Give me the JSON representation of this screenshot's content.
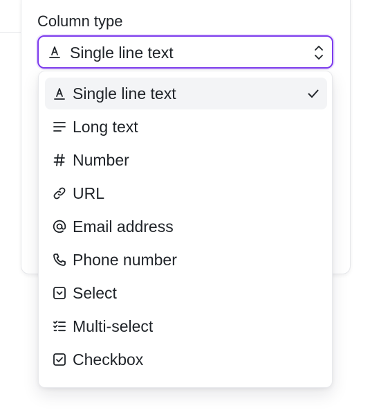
{
  "field": {
    "label": "Column type",
    "selected_value": "Single line text",
    "selected_icon": "text-a-underline-icon"
  },
  "menu": {
    "items": [
      {
        "label": "Single line text",
        "icon": "text-a-underline-icon",
        "selected": true
      },
      {
        "label": "Long text",
        "icon": "lines-icon",
        "selected": false
      },
      {
        "label": "Number",
        "icon": "hash-icon",
        "selected": false
      },
      {
        "label": "URL",
        "icon": "link-icon",
        "selected": false
      },
      {
        "label": "Email address",
        "icon": "at-sign-icon",
        "selected": false
      },
      {
        "label": "Phone number",
        "icon": "phone-icon",
        "selected": false
      },
      {
        "label": "Select",
        "icon": "select-box-icon",
        "selected": false
      },
      {
        "label": "Multi-select",
        "icon": "checklist-icon",
        "selected": false
      },
      {
        "label": "Checkbox",
        "icon": "checkbox-icon",
        "selected": false
      }
    ]
  },
  "colors": {
    "focus_ring": "#7c3aed",
    "selected_item_bg": "#f3f4f6",
    "text": "#1f2328"
  }
}
